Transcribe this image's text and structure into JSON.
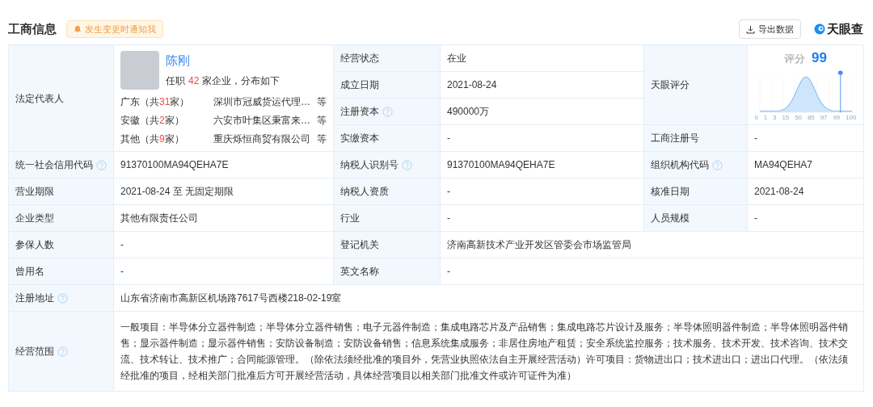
{
  "header": {
    "title": "工商信息",
    "notify_button": "发生变更时通知我",
    "export_button": "导出数据",
    "logo": "天眼查"
  },
  "legal_rep": {
    "label": "法定代表人",
    "name": "陈刚",
    "prefix": "任职",
    "count": "42",
    "suffix": "家企业，分布如下",
    "regions": [
      {
        "name": "广东",
        "open": "（共",
        "count": "31",
        "close": "家）",
        "company": "深圳市冠威货运代理…",
        "more": "等"
      },
      {
        "name": "安徽",
        "open": "（共",
        "count": "2",
        "close": "家）",
        "company": "六安市叶集区秉富来…",
        "more": "等"
      },
      {
        "name": "其他",
        "open": "（共",
        "count": "9",
        "close": "家）",
        "company": "重庆烁恒商贸有限公司",
        "more": "等"
      }
    ]
  },
  "top_fields": [
    {
      "label": "经营状态",
      "value": "在业",
      "help": false
    },
    {
      "label": "成立日期",
      "value": "2021-08-24",
      "help": false
    },
    {
      "label": "注册资本",
      "value": "490000万",
      "help": true
    },
    {
      "label": "实缴资本",
      "value": "-",
      "help": false
    }
  ],
  "score": {
    "label": "天眼评分",
    "caption": "评分",
    "value": "99",
    "axis_labels": [
      "0",
      "1",
      "3",
      "15",
      "50",
      "85",
      "97",
      "99",
      "100"
    ]
  },
  "registration_no": {
    "label": "工商注册号",
    "value": "-"
  },
  "rows": [
    {
      "cells": [
        {
          "kind": "label",
          "text": "统一社会信用代码",
          "help": true
        },
        {
          "kind": "value",
          "text": "91370100MA94QEHA7E"
        },
        {
          "kind": "label",
          "text": "纳税人识别号",
          "help": true
        },
        {
          "kind": "value",
          "text": "91370100MA94QEHA7E"
        },
        {
          "kind": "label",
          "text": "组织机构代码",
          "help": true
        },
        {
          "kind": "value",
          "text": "MA94QEHA7"
        }
      ]
    },
    {
      "cells": [
        {
          "kind": "label",
          "text": "营业期限",
          "help": false
        },
        {
          "kind": "value",
          "text": "2021-08-24  至 无固定期限"
        },
        {
          "kind": "label",
          "text": "纳税人资质",
          "help": false
        },
        {
          "kind": "value",
          "text": "-"
        },
        {
          "kind": "label",
          "text": "核准日期",
          "help": false
        },
        {
          "kind": "value",
          "text": "2021-08-24"
        }
      ]
    },
    {
      "cells": [
        {
          "kind": "label",
          "text": "企业类型",
          "help": false
        },
        {
          "kind": "value",
          "text": "其他有限责任公司"
        },
        {
          "kind": "label",
          "text": "行业",
          "help": false
        },
        {
          "kind": "value",
          "text": "-"
        },
        {
          "kind": "label",
          "text": "人员规模",
          "help": false
        },
        {
          "kind": "value",
          "text": "-"
        }
      ]
    },
    {
      "cells": [
        {
          "kind": "label",
          "text": "参保人数",
          "help": false
        },
        {
          "kind": "value",
          "text": "-"
        },
        {
          "kind": "label",
          "text": "登记机关",
          "help": false
        },
        {
          "kind": "value",
          "text": "济南高新技术产业开发区管委会市场监管局"
        }
      ]
    },
    {
      "cells": [
        {
          "kind": "label",
          "text": "曾用名",
          "help": false
        },
        {
          "kind": "value",
          "text": "-"
        },
        {
          "kind": "label",
          "text": "英文名称",
          "help": false
        },
        {
          "kind": "value",
          "text": "-"
        }
      ]
    },
    {
      "cells": [
        {
          "kind": "label",
          "text": "注册地址",
          "help": true
        },
        {
          "kind": "value",
          "text": "山东省济南市高新区机场路7617号西楼218-02-19室"
        }
      ]
    },
    {
      "cells": [
        {
          "kind": "label",
          "text": "经营范围",
          "help": true
        },
        {
          "kind": "value",
          "text": "一般项目：半导体分立器件制造；半导体分立器件销售；电子元器件制造；集成电路芯片及产品销售；集成电路芯片设计及服务；半导体照明器件制造；半导体照明器件销售；显示器件制造；显示器件销售；安防设备制造；安防设备销售；信息系统集成服务；非居住房地产租赁；安全系统监控服务；技术服务、技术开发、技术咨询、技术交流、技术转让、技术推广；合同能源管理。（除依法须经批准的项目外，凭营业执照依法自主开展经营活动）许可项目：货物进出口；技术进出口；进出口代理。（依法须经批准的项目，经相关部门批准后方可开展经营活动，具体经营项目以相关部门批准文件或许可证件为准）"
        }
      ]
    }
  ]
}
